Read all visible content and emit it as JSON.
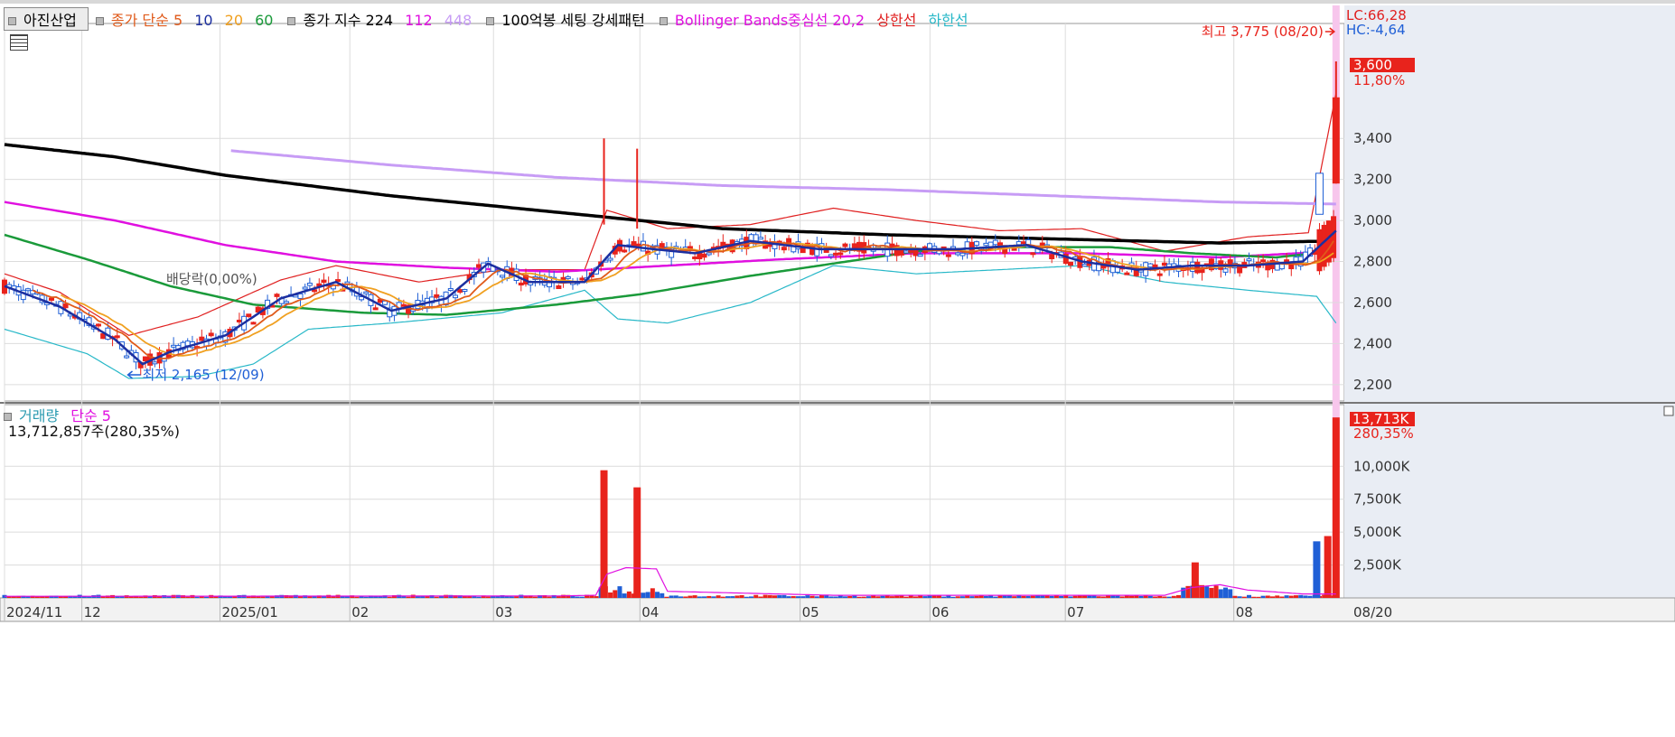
{
  "legend": {
    "stock_name": "아진산업",
    "ma_label": "종가 단순 5",
    "ma10": "10",
    "ma20": "20",
    "ma60": "60",
    "exp_label": "종가 지수 224",
    "exp112": "112",
    "exp448": "448",
    "setting": "100억봉 세팅 강세패턴",
    "bb_label": "Bollinger Bands중심선 20,2",
    "bb_upper": "상한선",
    "bb_lower": "하한선"
  },
  "volume_legend": {
    "label": "거래량",
    "ma": "단순 5",
    "value": "13,712,857주(280,35%)"
  },
  "right_info": {
    "lc": "LC:66,28",
    "hc": "HC:-4,64"
  },
  "annotations": {
    "high": "최고 3,775 (08/20)",
    "low": "최저 2,165 (12/09)",
    "dividend": "배당락(0,00%)",
    "price_badge": "3,600",
    "price_pct": "11,80%",
    "vol_badge": "13,713K",
    "vol_pct": "280,35%",
    "date_badge": "08/20"
  },
  "colors": {
    "up": "#e8231c",
    "down": "#1f5fd6",
    "ma5": "#1c2fa0",
    "ma10": "#e05a1a",
    "ma20": "#f0a020",
    "ma60": "#1a9a3a",
    "exp224": "#000000",
    "exp112": "#e010e0",
    "exp448": "#c79cf5",
    "bb_upper": "#e02020",
    "bb_lower": "#28b8c8",
    "highlight": "#f7c6ec"
  },
  "chart_data": {
    "type": "candlestick",
    "y_ticks": [
      "3,400",
      "3,200",
      "3,000",
      "2,800",
      "2,600",
      "2,400",
      "2,200"
    ],
    "ylim": [
      2120,
      3960
    ],
    "x_labels": [
      "2024/11",
      "12",
      "2025/01",
      "02",
      "03",
      "04",
      "05",
      "06",
      "07",
      "08"
    ],
    "x_label_days": [
      0,
      28,
      78,
      125,
      177,
      230,
      288,
      335,
      384,
      445
    ],
    "volume_ticks": [
      "10,000K",
      "7,500K",
      "5,000K",
      "2,500K"
    ],
    "volume_ylim": [
      0,
      14000
    ],
    "days": 485,
    "key_points": {
      "high": {
        "date": "08/20",
        "value": 3775
      },
      "low": {
        "date": "12/09",
        "value": 2165
      },
      "close": 3600
    },
    "series": [
      {
        "name": "종가 지수 224",
        "points": [
          [
            0,
            3370
          ],
          [
            40,
            3310
          ],
          [
            80,
            3220
          ],
          [
            140,
            3120
          ],
          [
            200,
            3040
          ],
          [
            260,
            2960
          ],
          [
            320,
            2930
          ],
          [
            380,
            2910
          ],
          [
            440,
            2890
          ],
          [
            482,
            2900
          ]
        ]
      },
      {
        "name": "종가 지수 112",
        "points": [
          [
            0,
            3090
          ],
          [
            40,
            3000
          ],
          [
            80,
            2880
          ],
          [
            120,
            2800
          ],
          [
            160,
            2770
          ],
          [
            200,
            2750
          ],
          [
            240,
            2780
          ],
          [
            280,
            2810
          ],
          [
            330,
            2840
          ],
          [
            390,
            2840
          ],
          [
            440,
            2820
          ],
          [
            482,
            2850
          ]
        ]
      },
      {
        "name": "종가 지수 448",
        "points": [
          [
            82,
            3340
          ],
          [
            140,
            3270
          ],
          [
            200,
            3210
          ],
          [
            260,
            3170
          ],
          [
            320,
            3150
          ],
          [
            380,
            3120
          ],
          [
            440,
            3090
          ],
          [
            482,
            3080
          ]
        ]
      },
      {
        "name": "60",
        "points": [
          [
            0,
            2930
          ],
          [
            30,
            2810
          ],
          [
            60,
            2680
          ],
          [
            90,
            2590
          ],
          [
            130,
            2550
          ],
          [
            160,
            2540
          ],
          [
            200,
            2590
          ],
          [
            230,
            2640
          ],
          [
            270,
            2730
          ],
          [
            300,
            2790
          ],
          [
            330,
            2850
          ],
          [
            360,
            2870
          ],
          [
            400,
            2870
          ],
          [
            430,
            2840
          ],
          [
            460,
            2820
          ],
          [
            482,
            2850
          ]
        ]
      },
      {
        "name": "Bollinger 상한선",
        "points": [
          [
            0,
            2740
          ],
          [
            20,
            2650
          ],
          [
            45,
            2440
          ],
          [
            70,
            2530
          ],
          [
            100,
            2710
          ],
          [
            120,
            2780
          ],
          [
            150,
            2700
          ],
          [
            180,
            2760
          ],
          [
            210,
            2760
          ],
          [
            218,
            3050
          ],
          [
            240,
            2960
          ],
          [
            270,
            2980
          ],
          [
            300,
            3060
          ],
          [
            330,
            3000
          ],
          [
            360,
            2950
          ],
          [
            390,
            2960
          ],
          [
            420,
            2850
          ],
          [
            450,
            2920
          ],
          [
            472,
            2940
          ],
          [
            482,
            3620
          ]
        ]
      },
      {
        "name": "Bollinger 하한선",
        "points": [
          [
            0,
            2470
          ],
          [
            30,
            2350
          ],
          [
            45,
            2230
          ],
          [
            70,
            2240
          ],
          [
            90,
            2300
          ],
          [
            110,
            2470
          ],
          [
            140,
            2500
          ],
          [
            180,
            2550
          ],
          [
            210,
            2660
          ],
          [
            222,
            2520
          ],
          [
            240,
            2500
          ],
          [
            270,
            2600
          ],
          [
            300,
            2780
          ],
          [
            330,
            2740
          ],
          [
            360,
            2760
          ],
          [
            390,
            2780
          ],
          [
            420,
            2700
          ],
          [
            450,
            2660
          ],
          [
            475,
            2630
          ],
          [
            482,
            2500
          ]
        ]
      },
      {
        "name": "5",
        "points": [
          [
            0,
            2680
          ],
          [
            20,
            2580
          ],
          [
            40,
            2420
          ],
          [
            50,
            2300
          ],
          [
            60,
            2360
          ],
          [
            80,
            2440
          ],
          [
            100,
            2620
          ],
          [
            120,
            2700
          ],
          [
            140,
            2560
          ],
          [
            160,
            2620
          ],
          [
            175,
            2790
          ],
          [
            190,
            2700
          ],
          [
            210,
            2700
          ],
          [
            222,
            2880
          ],
          [
            235,
            2860
          ],
          [
            250,
            2840
          ],
          [
            270,
            2900
          ],
          [
            295,
            2860
          ],
          [
            320,
            2860
          ],
          [
            345,
            2860
          ],
          [
            370,
            2880
          ],
          [
            390,
            2800
          ],
          [
            410,
            2760
          ],
          [
            430,
            2780
          ],
          [
            450,
            2780
          ],
          [
            470,
            2800
          ],
          [
            482,
            2950
          ]
        ]
      }
    ],
    "annotations_days": {
      "high_day": 482,
      "low_day": 44
    },
    "volume_spikes": [
      [
        217,
        9700
      ],
      [
        229,
        8400
      ],
      [
        431,
        2700
      ],
      [
        475,
        4300
      ],
      [
        479,
        4700
      ],
      [
        482,
        13713
      ]
    ]
  }
}
